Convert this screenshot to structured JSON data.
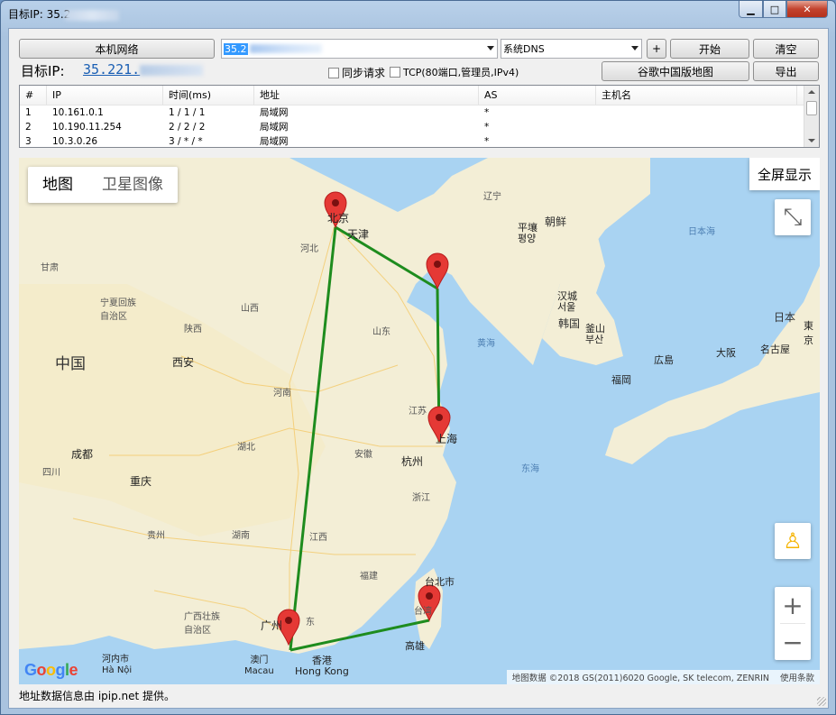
{
  "window": {
    "title": "目标IP: 35.2",
    "controls": {
      "minimize": "▁",
      "maximize": "□",
      "close": "✕"
    }
  },
  "toolbar": {
    "local_network_label": "本机网络",
    "target_input_value": "35.2",
    "dns_select_value": "系统DNS",
    "add_label": "+",
    "start_label": "开始",
    "clear_label": "清空",
    "google_map_label": "谷歌中国版地图",
    "export_label": "导出",
    "target_ip_label": "目标IP:",
    "target_ip_value": "35.221.",
    "sync_request_label": "同步请求",
    "tcp_label": "TCP(80端口,管理员,IPv4)"
  },
  "table": {
    "headers": [
      "#",
      "IP",
      "时间(ms)",
      "地址",
      "AS",
      "主机名"
    ],
    "rows": [
      [
        "1",
        "10.161.0.1",
        "1 / 1 / 1",
        "局域网",
        "*",
        ""
      ],
      [
        "2",
        "10.190.11.254",
        "2 / 2 / 2",
        "局域网",
        "*",
        ""
      ],
      [
        "3",
        "10.3.0.26",
        "3 / * / *",
        "局域网",
        "*",
        ""
      ]
    ]
  },
  "map": {
    "type_map": "地图",
    "type_satellite": "卫星图像",
    "fullscreen_label": "全屏显示",
    "zoom_in": "+",
    "zoom_out": "−",
    "google_logo": "Google",
    "attribution": "地图数据 ©2018 GS(2011)6020 Google, SK telecom, ZENRIN",
    "terms": "使用条款",
    "route_color": "#1e8c1e",
    "pin_color": "#e53935",
    "labels": {
      "china": "中国",
      "beijing": "北京",
      "tianjin": "天津",
      "hebei": "河北",
      "gansu": "甘肃",
      "ningxia": "宁夏回族\n自治区",
      "shaanxi": "陕西",
      "shanxi": "山西",
      "xian": "西安",
      "shandong": "山东",
      "henan": "河南",
      "jiangsu": "江苏",
      "anhui": "安徽",
      "hubei": "湖北",
      "shanghai": "上海",
      "hangzhou": "杭州",
      "zhejiang": "浙江",
      "chengdu": "成都",
      "sichuan": "四川",
      "chongqing": "重庆",
      "guizhou": "贵州",
      "hunan": "湖南",
      "jiangxi": "江西",
      "fujian": "福建",
      "guangxi": "广西壮族\n自治区",
      "guangzhou": "广州",
      "guangdong": "东",
      "macau": "澳门\nMacau",
      "hongkong": "香港\nHong Kong",
      "hanoi": "河内市\nHà Nội",
      "taipei": "台北市",
      "taiwan": "台湾",
      "kaohsiung": "高雄",
      "liaoning": "辽宁",
      "pyongyang": "平壤\n평양",
      "north_korea": "朝鲜",
      "seoul": "汉城\n서울",
      "south_korea": "韩国",
      "busan": "釜山\n부산",
      "yellow_sea": "黄海",
      "east_sea": "东海",
      "sea_of_japan": "日本海",
      "japan": "日本",
      "tokyo": "東京",
      "osaka": "大阪",
      "nagoya": "名古屋",
      "hiroshima": "広島",
      "fukuoka": "福岡"
    }
  },
  "status_text": "地址数据信息由 ipip.net 提供。"
}
